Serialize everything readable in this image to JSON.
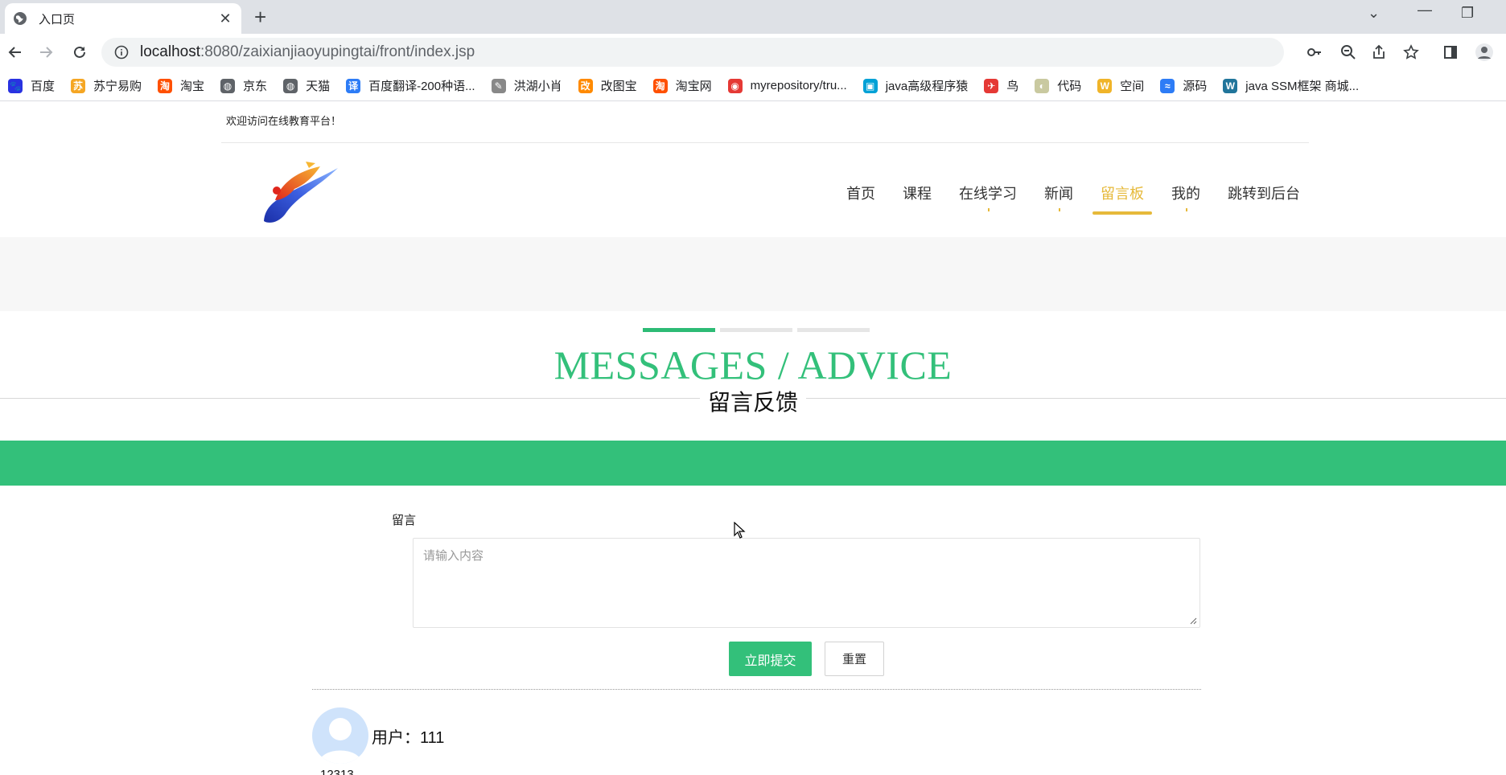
{
  "browser": {
    "tab_title": "入口页",
    "url_host": "localhost",
    "url_rest": ":8080/zaixianjiaoyupingtai/front/index.jsp",
    "bookmarks": [
      {
        "label": "百度",
        "color": "#2932e1",
        "glyph": "🐾"
      },
      {
        "label": "苏宁易购",
        "color": "#f5a623",
        "glyph": "苏"
      },
      {
        "label": "淘宝",
        "color": "#ff5000",
        "glyph": "淘"
      },
      {
        "label": "京东",
        "color": "#5f6368",
        "glyph": "◍"
      },
      {
        "label": "天猫",
        "color": "#5f6368",
        "glyph": "◍"
      },
      {
        "label": "百度翻译-200种语...",
        "color": "#2d7cf6",
        "glyph": "译"
      },
      {
        "label": "洪湖小肖",
        "color": "#888888",
        "glyph": "✎"
      },
      {
        "label": "改图宝",
        "color": "#ff8a00",
        "glyph": "改"
      },
      {
        "label": "淘宝网",
        "color": "#ff5000",
        "glyph": "淘"
      },
      {
        "label": "myrepository/tru...",
        "color": "#e53935",
        "glyph": "◉"
      },
      {
        "label": "java高级程序猿",
        "color": "#00a1d6",
        "glyph": "▣"
      },
      {
        "label": "鸟",
        "color": "#e53935",
        "glyph": "✈"
      },
      {
        "label": "代码",
        "color": "#c9c9a0",
        "glyph": "◐"
      },
      {
        "label": "空间",
        "color": "#f0b429",
        "glyph": "W"
      },
      {
        "label": "源码",
        "color": "#2d7cf6",
        "glyph": "≈"
      },
      {
        "label": "java SSM框架 商城...",
        "color": "#21759b",
        "glyph": "W"
      }
    ]
  },
  "site": {
    "welcome": "欢迎访问在线教育平台！",
    "nav": [
      {
        "label": "首页",
        "active": false,
        "tick": false
      },
      {
        "label": "课程",
        "active": false,
        "tick": false
      },
      {
        "label": "在线学习",
        "active": false,
        "tick": true
      },
      {
        "label": "新闻",
        "active": false,
        "tick": true
      },
      {
        "label": "留言板",
        "active": true,
        "tick": false
      },
      {
        "label": "我的",
        "active": false,
        "tick": true
      },
      {
        "label": "跳转到后台",
        "active": false,
        "tick": false
      }
    ],
    "accent_color": "#33c07a",
    "nav_active_color": "#e6b93a"
  },
  "section": {
    "title_en": "MESSAGES / ADVICE",
    "title_cn": "留言反馈"
  },
  "form": {
    "label": "留言",
    "placeholder": "请输入内容",
    "submit_label": "立即提交",
    "reset_label": "重置"
  },
  "messages": [
    {
      "user_label": "用户：111",
      "text": "12313"
    }
  ]
}
